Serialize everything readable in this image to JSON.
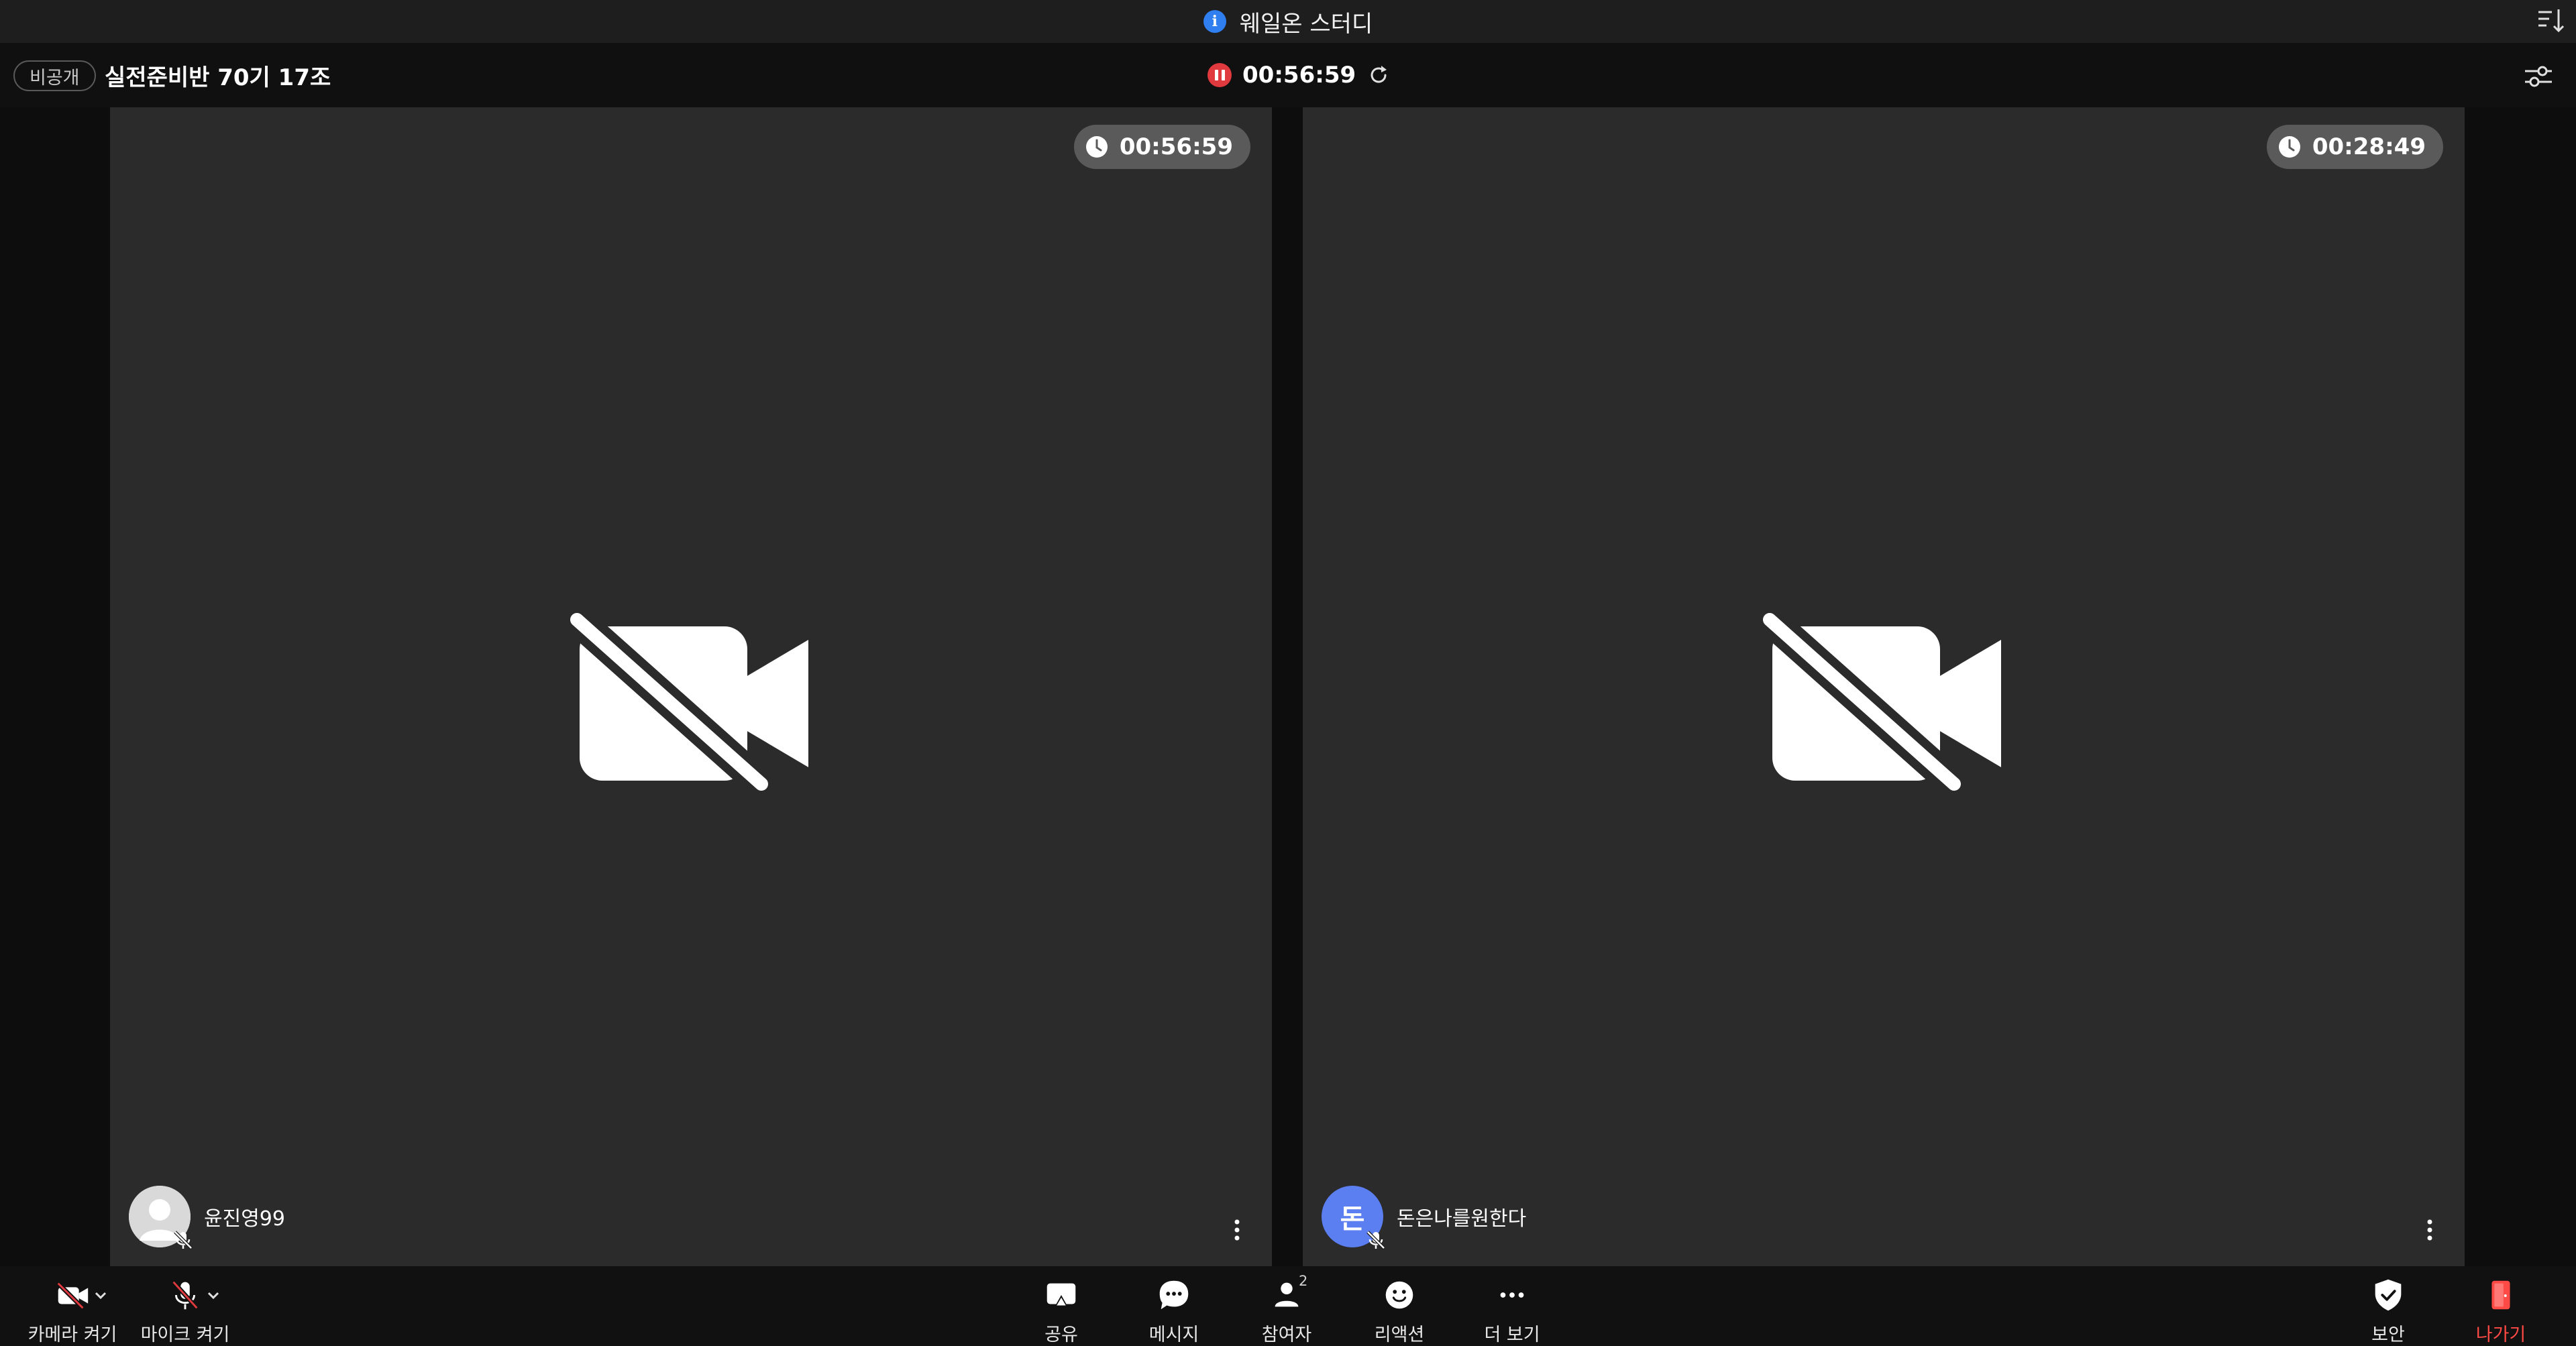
{
  "window": {
    "title": "웨일온 스터디"
  },
  "header": {
    "privacy_label": "비공개",
    "meeting_name": "실전준비반 70기 17조",
    "recording_time": "00:56:59"
  },
  "tiles": [
    {
      "time": "00:56:59",
      "participant_name": "윤진영99",
      "avatar_type": "default-profile"
    },
    {
      "time": "00:28:49",
      "participant_name": "돈은나를원한다",
      "avatar_initial": "돈",
      "avatar_color": "#5b7ef0"
    }
  ],
  "toolbar": {
    "camera_label": "카메라 켜기",
    "mic_label": "마이크 켜기",
    "share_label": "공유",
    "message_label": "메시지",
    "participants_label": "참여자",
    "participants_count": "2",
    "reaction_label": "리액션",
    "more_label": "더 보기",
    "security_label": "보안",
    "leave_label": "나가기"
  },
  "colors": {
    "accent_blue": "#2f7ff0",
    "record_red": "#e0393e",
    "leave_red": "#ff4a45",
    "tile_bg": "#2b2b2b"
  }
}
